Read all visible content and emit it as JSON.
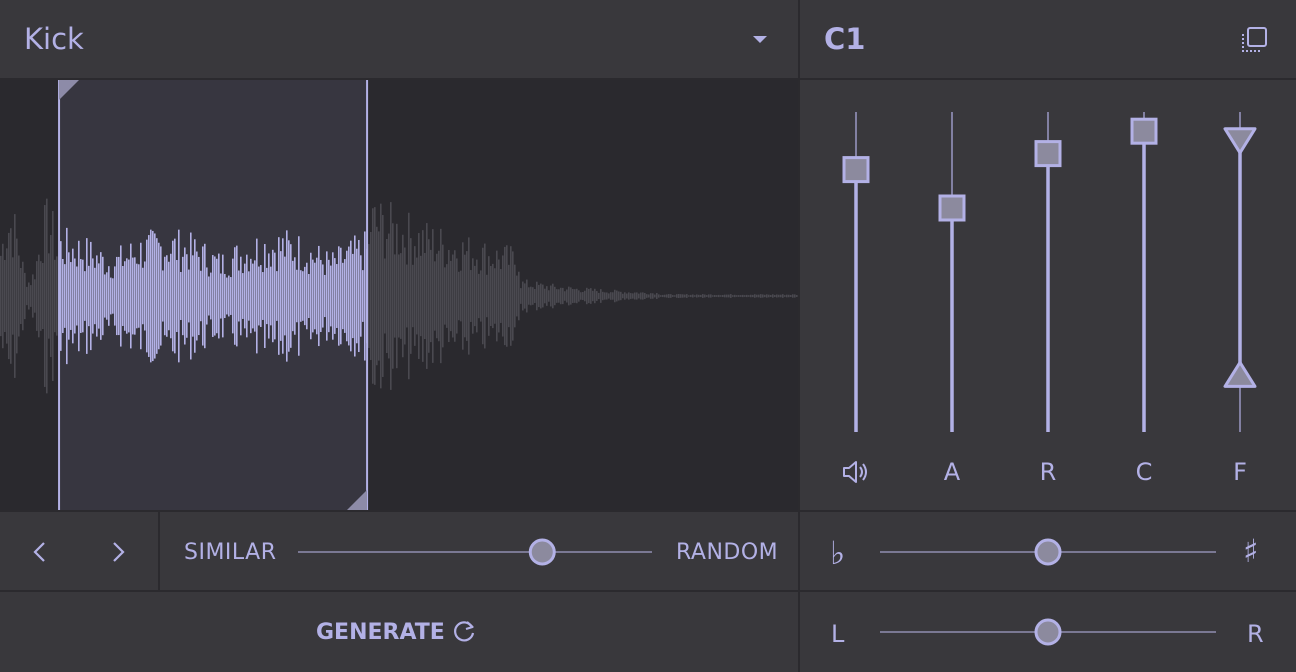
{
  "header": {
    "sample_name": "Kick",
    "note": "C1"
  },
  "sliders": {
    "volume": {
      "label_icon": "speaker-icon",
      "value": 0.82
    },
    "attack": {
      "label": "A",
      "value": 0.7
    },
    "release": {
      "label": "R",
      "value": 0.87
    },
    "curve": {
      "label": "C",
      "value": 0.94
    },
    "filter": {
      "label": "F",
      "high": 0.91,
      "low": 0.18
    }
  },
  "variation": {
    "left_label": "SIMILAR",
    "right_label": "RANDOM",
    "value": 0.69
  },
  "pitch": {
    "left_label": "♭",
    "right_label": "♯",
    "value": 0.5
  },
  "pan": {
    "left_label": "L",
    "right_label": "R",
    "value": 0.5
  },
  "generate": {
    "label": "GENERATE"
  },
  "waveform": {
    "selection_start": 0.074,
    "selection_end": 0.46
  },
  "colors": {
    "accent": "#b3b1e6",
    "background": "#39383c",
    "wave_bg": "#2a292e",
    "wave_dim": "#4a4950"
  }
}
